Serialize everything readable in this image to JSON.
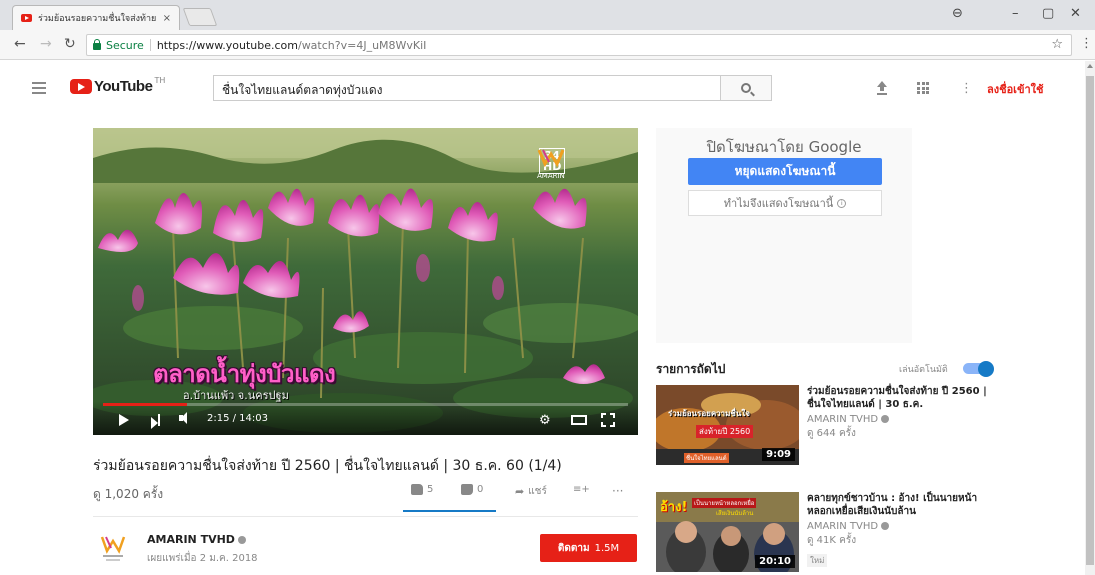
{
  "browser": {
    "tab_title": "ร่วมย้อนรอยความชื่นใจส่งท้าย",
    "tab_close": "×",
    "secure_label": "Secure",
    "url_host": "https://www.youtube.com",
    "url_path": "/watch?v=4J_uM8WvKiI",
    "star": "☆",
    "menu": "⋮",
    "account_glyph": "⊖",
    "minimize": "–",
    "restore": "▢",
    "close": "✕"
  },
  "masthead": {
    "logo_text": "YouTube",
    "logo_region": "TH",
    "search_value": "ชื่นใจไทยแลนด์ตลาดทุ่งบัวแดง",
    "more_glyph": "⋮",
    "signin_label": "ลงชื่อเข้าใช้"
  },
  "player": {
    "caption": "ตลาดน้ำทุ่งบัวแดง",
    "subcaption": "อ.บ้านแพ้ว จ.นครปฐม",
    "channel_badge_number": "34",
    "channel_badge_hd": "HD",
    "channel_badge_name": "AMARIN",
    "time": "2:15 / 14:03",
    "progress_fraction": 0.16,
    "settings_glyph": "⚙"
  },
  "video": {
    "title": "ร่วมย้อนรอยความชื่นใจส่งท้าย ปี 2560 | ชื่นใจไทยแลนด์ | 30 ธ.ค. 60 (1/4)",
    "views": "ดู 1,020 ครั้ง",
    "likes": "5",
    "dislikes": "0",
    "share_label": "แชร์",
    "add_glyph": "≡+",
    "more": "···",
    "like_fraction": 1.0
  },
  "owner": {
    "name": "AMARIN TVHD",
    "published": "เผยแพร่เมื่อ 2 ม.ค. 2018",
    "subscribe_label": "ติดตาม",
    "subscriber_count": "1.5M"
  },
  "ad": {
    "title": "ปิดโฆษณาโดย Google",
    "stop_label": "หยุดแสดงโฆษณานี้",
    "why_label": "ทำไมจึงแสดงโฆษณานี้",
    "info_glyph": "i"
  },
  "upnext": {
    "heading": "รายการถัดไป",
    "autoplay_label": "เล่นอัตโนมัติ",
    "autoplay_on": true,
    "items": [
      {
        "title": "ร่วมย้อนรอยความชื่นใจส่งท้าย ปี 2560 | ชื่นใจไทยแลนด์ | 30 ธ.ค.",
        "channel": "AMARIN TVHD",
        "views": "ดู 644 ครั้ง",
        "duration": "9:09",
        "thumb_text_1": "ร่วมย้อนรอยความชื่นใจ",
        "thumb_text_2": "ส่งท้ายปี 2560",
        "thumb_text_3": "ชื่นใจไทยแลนด์"
      },
      {
        "title": "คลายทุกข์ชาวบ้าน : อ้าง! เป็นนายหน้าหลอกเหยื่อเสียเงินนับล้าน",
        "channel": "AMARIN TVHD",
        "views": "ดู 41K ครั้ง",
        "badge": "ใหม่",
        "duration": "20:10",
        "thumb_text_1": "อ้าง!",
        "thumb_text_2": "เป็นนายหน้าหลอกเหยื่อ",
        "thumb_text_3": "เสียเงินนับล้าน"
      }
    ]
  },
  "colors": {
    "youtube_red": "#e62117",
    "ad_blue": "#4285f4",
    "toggle_blue": "#167ac6",
    "secure_green": "#0b8043"
  }
}
